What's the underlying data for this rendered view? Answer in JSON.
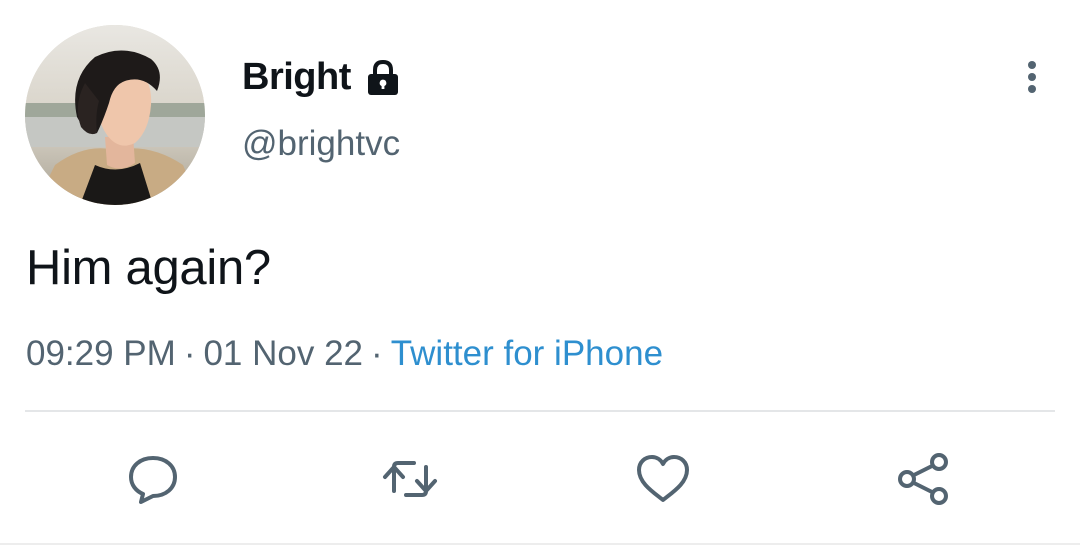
{
  "tweet": {
    "display_name": "Bright",
    "handle": "@brightvc",
    "text": "Him again?",
    "time": "09:29 PM",
    "date": "01 Nov 22",
    "source": "Twitter for iPhone",
    "separator": "·"
  },
  "icons": {
    "lock": "lock-icon",
    "more": "more-vertical-icon",
    "reply": "reply-icon",
    "retweet": "retweet-icon",
    "like": "heart-icon",
    "share": "share-icon"
  },
  "colors": {
    "text": "#0f1419",
    "secondary": "#536471",
    "link": "#2e8fcf",
    "divider": "#e4e6e8"
  }
}
